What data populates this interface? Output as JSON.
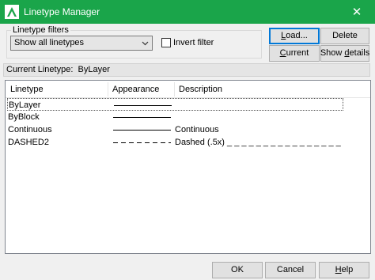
{
  "window": {
    "title": "Linetype Manager",
    "close_glyph": "✕"
  },
  "filters": {
    "group_label": "Linetype filters",
    "selected_option": "Show all linetypes",
    "invert_label": "Invert filter",
    "invert_checked": false
  },
  "buttons": {
    "load_prefix": "L",
    "load_rest": "oad...",
    "delete": "Delete",
    "current_prefix": "C",
    "current_rest": "urrent",
    "show_prefix": "Show ",
    "show_u": "d",
    "show_rest": "etails",
    "ok": "OK",
    "cancel": "Cancel",
    "help_prefix": "H",
    "help_rest": "elp"
  },
  "current_linetype": {
    "label": "Current Linetype:",
    "value": "ByLayer"
  },
  "table": {
    "headers": [
      "Linetype",
      "Appearance",
      "Description"
    ],
    "rows": [
      {
        "name": "ByLayer",
        "appearance": "solid",
        "description": "",
        "selected": true
      },
      {
        "name": "ByBlock",
        "appearance": "solid",
        "description": "",
        "selected": false
      },
      {
        "name": "Continuous",
        "appearance": "solid",
        "description": "Continuous",
        "selected": false
      },
      {
        "name": "DASHED2",
        "appearance": "dashed",
        "description": "Dashed (.5x) _ _ _ _ _ _ _ _ _ _ _ _ _ _ _ _",
        "selected": false
      }
    ]
  },
  "icons": {
    "app": "autocad-a-icon",
    "combo_arrow": "chevron-down-icon",
    "close": "close-icon"
  },
  "colors": {
    "titlebar": "#1aa54a",
    "focus": "#0078d7"
  }
}
